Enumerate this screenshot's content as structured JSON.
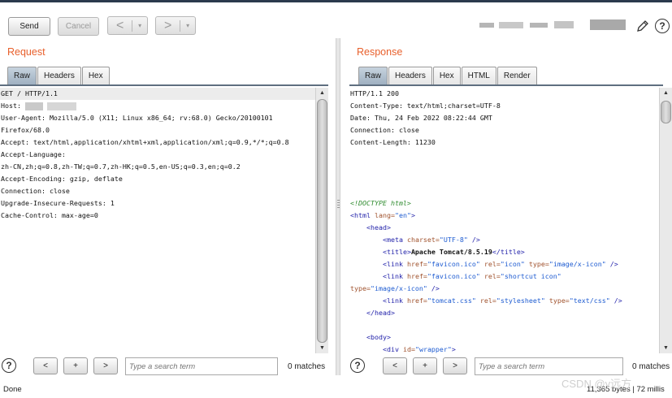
{
  "toolbar": {
    "send_label": "Send",
    "cancel_label": "Cancel",
    "back_label": "<",
    "forward_label": ">",
    "dropdown_label": "▾",
    "help_label": "?"
  },
  "request": {
    "title": "Request",
    "tabs": [
      "Raw",
      "Headers",
      "Hex"
    ],
    "active_tab": "Raw",
    "lines": [
      "GET / HTTP/1.1",
      "Host: ",
      "User-Agent: Mozilla/5.0 (X11; Linux x86_64; rv:68.0) Gecko/20100101",
      "Firefox/68.0",
      "Accept: text/html,application/xhtml+xml,application/xml;q=0.9,*/*;q=0.8",
      "Accept-Language:",
      "zh-CN,zh;q=0.8,zh-TW;q=0.7,zh-HK;q=0.5,en-US;q=0.3,en;q=0.2",
      "Accept-Encoding: gzip, deflate",
      "Connection: close",
      "Upgrade-Insecure-Requests: 1",
      "Cache-Control: max-age=0"
    ],
    "search_placeholder": "Type a search term",
    "matches": "0 matches",
    "prev_label": "<",
    "add_label": "+",
    "next_label": ">",
    "help_label": "?"
  },
  "response": {
    "title": "Response",
    "tabs": [
      "Raw",
      "Headers",
      "Hex",
      "HTML",
      "Render"
    ],
    "active_tab": "Raw",
    "headers": [
      "HTTP/1.1 200",
      "Content-Type: text/html;charset=UTF-8",
      "Date: Thu, 24 Feb 2022 08:22:44 GMT",
      "Connection: close",
      "Content-Length: 11230"
    ],
    "body": {
      "doctype": "<!DOCTYPE html>",
      "html_open_tag": "<html",
      "lang_attr": "lang=",
      "lang_value": "\"en\"",
      "close_bracket": ">",
      "head_open": "<head>",
      "meta_tag": "<meta",
      "meta_attr": "charset=",
      "meta_value": "\"UTF-8\"",
      "self_close": " />",
      "title_open": "<title>",
      "title_text": "Apache Tomcat/8.5.19",
      "title_close": "</title>",
      "link_tag": "<link",
      "href_attr": "href=",
      "rel_attr": "rel=",
      "type_attr": "type=",
      "favicon_value": "\"favicon.ico\"",
      "rel_icon_value": "\"icon\"",
      "rel_shortcut_value": "\"shortcut icon\"",
      "type_icon_value": "\"image/x-icon\"",
      "css_href_value": "\"tomcat.css\"",
      "rel_stylesheet_value": "\"stylesheet\"",
      "type_css_value": "\"text/css\"",
      "head_close": "</head>",
      "body_open": "<body>",
      "div_tag": "<div",
      "id_attr": "id=",
      "div_id_value": "\"wrapper\""
    },
    "search_placeholder": "Type a search term",
    "matches": "0 matches",
    "prev_label": "<",
    "add_label": "+",
    "next_label": ">",
    "help_label": "?"
  },
  "status": {
    "left": "Done",
    "right": "11,365 bytes | 72 millis"
  },
  "watermark": "CSDN @y远方",
  "colors": {
    "title_orange": "#e8602c",
    "active_tab": "#a9b9c9",
    "tag_blue": "#2222aa",
    "attr_brown": "#a0522d",
    "value_blue": "#1d5bd1",
    "comment_green": "#2e8b2e"
  }
}
